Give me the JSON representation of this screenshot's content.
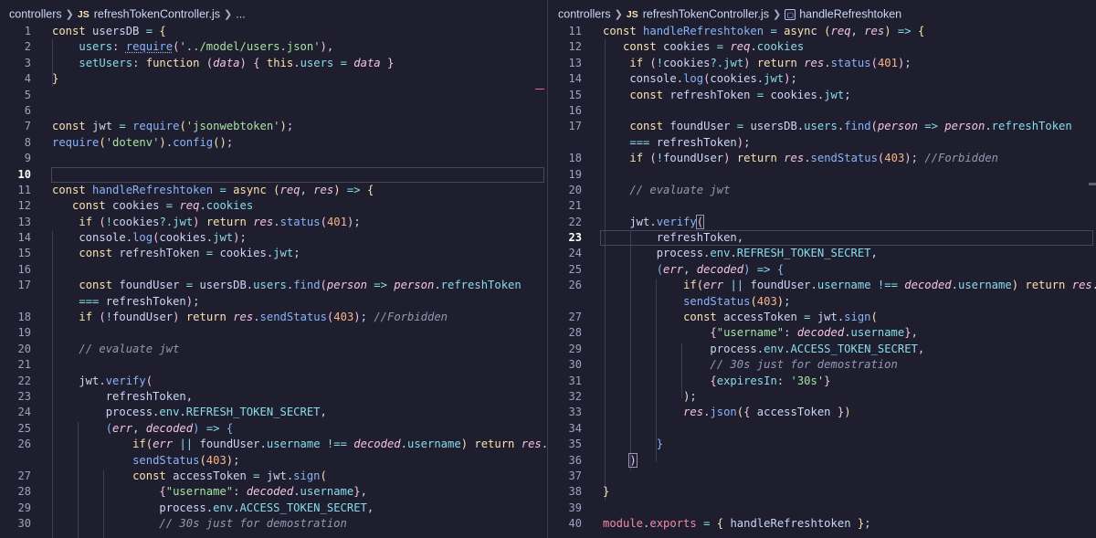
{
  "colors": {
    "background": "#1e1e2e",
    "keyword": "#f9e2af",
    "string": "#a6e3a1",
    "function": "#89b4fa",
    "parameter": "#f5c2e7",
    "comment": "#9399b2"
  },
  "left_editor": {
    "breadcrumb": {
      "folder": "controllers",
      "file_badge": "JS",
      "file": "refreshTokenController.js",
      "tail": "..."
    },
    "current_line": "10",
    "lines": [
      {
        "n": "1",
        "h": "<span class=\"kw\">const</span> usersDB <span class=\"op\">=</span> <span class=\"br1\">{</span>"
      },
      {
        "n": "2",
        "h": "    <span class=\"prop\">users</span>: <span class=\"fn sq\">require</span><span class=\"br2\">(</span><span class=\"str\">'../model/users.json'</span><span class=\"br2\">)</span>,"
      },
      {
        "n": "3",
        "h": "    <span class=\"prop\">setUsers</span>: <span class=\"kw\">function</span> <span class=\"br2\">(</span><span class=\"param\">data</span><span class=\"br2\">)</span> <span class=\"br2\">{</span> <span class=\"kw\">this</span>.<span class=\"prop\">users</span> <span class=\"op\">=</span> <span class=\"param\">data</span> <span class=\"br2\">}</span>"
      },
      {
        "n": "4",
        "h": "<span class=\"br1\">}</span>"
      },
      {
        "n": "5",
        "h": ""
      },
      {
        "n": "6",
        "h": ""
      },
      {
        "n": "7",
        "h": "<span class=\"kw\">const</span> jwt <span class=\"op\">=</span> <span class=\"fn\">require</span><span class=\"br1\">(</span><span class=\"str\">'jsonwebtoken'</span><span class=\"br1\">)</span>;"
      },
      {
        "n": "8",
        "h": "<span class=\"fn\">require</span><span class=\"br1\">(</span><span class=\"str\">'dotenv'</span><span class=\"br1\">)</span>.<span class=\"fn\">config</span><span class=\"br1\">()</span>;"
      },
      {
        "n": "9",
        "h": ""
      },
      {
        "n": "10",
        "h": ""
      },
      {
        "n": "11",
        "h": "<span class=\"kw\">const</span> <span class=\"fn\">handleRefreshtoken</span> <span class=\"op\">=</span> <span class=\"kw\">async</span> <span class=\"br1\">(</span><span class=\"param\">req</span>, <span class=\"param\">res</span><span class=\"br1\">)</span> <span class=\"op\">=&gt;</span> <span class=\"br1\">{</span>"
      },
      {
        "n": "12",
        "h": "   <span class=\"kw\">const</span> cookies <span class=\"op\">=</span> <span class=\"param\">req</span>.<span class=\"prop\">cookies</span>"
      },
      {
        "n": "13",
        "h": "    <span class=\"kw\">if</span> <span class=\"br2\">(</span><span class=\"op\">!</span>cookies<span class=\"op\">?.</span><span class=\"prop\">jwt</span><span class=\"br2\">)</span> <span class=\"kw\">return</span> <span class=\"param\">res</span>.<span class=\"fn\">status</span><span class=\"br2\">(</span><span class=\"num\">401</span><span class=\"br2\">)</span>;"
      },
      {
        "n": "14",
        "h": "    console.<span class=\"fn\">log</span><span class=\"br2\">(</span>cookies.<span class=\"prop\">jwt</span><span class=\"br2\">)</span>;"
      },
      {
        "n": "15",
        "h": "    <span class=\"kw\">const</span> refreshToken <span class=\"op\">=</span> cookies.<span class=\"prop\">jwt</span>;"
      },
      {
        "n": "16",
        "h": ""
      },
      {
        "n": "17",
        "h": "    <span class=\"kw\">const</span> foundUser <span class=\"op\">=</span> usersDB.<span class=\"prop\">users</span>.<span class=\"fn\">find</span><span class=\"br2\">(</span><span class=\"param\">person</span> <span class=\"op\">=&gt;</span> <span class=\"param\">person</span>.<span class=\"prop\">refreshToken</span>"
      },
      {
        "n": "",
        "h": "    <span class=\"op\">===</span> refreshToken<span class=\"br2\">)</span>;"
      },
      {
        "n": "18",
        "h": "    <span class=\"kw\">if</span> <span class=\"br2\">(</span><span class=\"op\">!</span>foundUser<span class=\"br2\">)</span> <span class=\"kw\">return</span> <span class=\"param\">res</span>.<span class=\"fn\">sendStatus</span><span class=\"br2\">(</span><span class=\"num\">403</span><span class=\"br2\">)</span>; <span class=\"cmt\">//Forbidden</span>"
      },
      {
        "n": "19",
        "h": ""
      },
      {
        "n": "20",
        "h": "    <span class=\"cmt\">// evaluate jwt</span>"
      },
      {
        "n": "21",
        "h": ""
      },
      {
        "n": "22",
        "h": "    jwt.<span class=\"fn\">verify</span><span class=\"br2\">(</span>"
      },
      {
        "n": "23",
        "h": "        refreshToken,"
      },
      {
        "n": "24",
        "h": "        process.<span class=\"prop\">env</span>.<span class=\"prop\">REFRESH_TOKEN_SECRET</span>,"
      },
      {
        "n": "25",
        "h": "        <span class=\"br3\">(</span><span class=\"param\">err</span>, <span class=\"param\">decoded</span><span class=\"br3\">)</span> <span class=\"op\">=&gt;</span> <span class=\"br3\">{</span>"
      },
      {
        "n": "26",
        "h": "            <span class=\"kw\">if</span><span class=\"br1\">(</span><span class=\"param\">err</span> <span class=\"op\">||</span> foundUser.<span class=\"prop\">username</span> <span class=\"op\">!==</span> <span class=\"param\">decoded</span>.<span class=\"prop\">username</span><span class=\"br1\">)</span> <span class=\"kw\">return</span> <span class=\"param\">res</span>."
      },
      {
        "n": "",
        "h": "            <span class=\"fn\">sendStatus</span><span class=\"br1\">(</span><span class=\"num\">403</span><span class=\"br1\">)</span>;"
      },
      {
        "n": "27",
        "h": "            <span class=\"kw\">const</span> accessToken <span class=\"op\">=</span> jwt.<span class=\"fn\">sign</span><span class=\"br1\">(</span>"
      },
      {
        "n": "28",
        "h": "                <span class=\"br2\">{</span><span class=\"str\">\"username\"</span>: <span class=\"param\">decoded</span>.<span class=\"prop\">username</span><span class=\"br2\">}</span>,"
      },
      {
        "n": "29",
        "h": "                process.<span class=\"prop\">env</span>.<span class=\"prop\">ACCESS_TOKEN_SECRET</span>,"
      },
      {
        "n": "30",
        "h": "                <span class=\"cmt\">// 30s just for demostration</span>"
      }
    ]
  },
  "right_editor": {
    "breadcrumb": {
      "folder": "controllers",
      "file_badge": "JS",
      "file": "refreshTokenController.js",
      "symbol": "handleRefreshtoken"
    },
    "current_line": "23",
    "lines": [
      {
        "n": "11",
        "h": "<span class=\"kw\">const</span> <span class=\"fn\">handleRefreshtoken</span> <span class=\"op\">=</span> <span class=\"kw\">async</span> <span class=\"br1\">(</span><span class=\"param\">req</span>, <span class=\"param\">res</span><span class=\"br1\">)</span> <span class=\"op\">=&gt;</span> <span class=\"br1\">{</span>"
      },
      {
        "n": "12",
        "h": "   <span class=\"kw\">const</span> cookies <span class=\"op\">=</span> <span class=\"param\">req</span>.<span class=\"prop\">cookies</span>"
      },
      {
        "n": "13",
        "h": "    <span class=\"kw\">if</span> <span class=\"br2\">(</span><span class=\"op\">!</span>cookies<span class=\"op\">?.</span><span class=\"prop\">jwt</span><span class=\"br2\">)</span> <span class=\"kw\">return</span> <span class=\"param\">res</span>.<span class=\"fn\">status</span><span class=\"br2\">(</span><span class=\"num\">401</span><span class=\"br2\">)</span>;"
      },
      {
        "n": "14",
        "h": "    console.<span class=\"fn\">log</span><span class=\"br2\">(</span>cookies.<span class=\"prop\">jwt</span><span class=\"br2\">)</span>;"
      },
      {
        "n": "15",
        "h": "    <span class=\"kw\">const</span> refreshToken <span class=\"op\">=</span> cookies.<span class=\"prop\">jwt</span>;"
      },
      {
        "n": "16",
        "h": ""
      },
      {
        "n": "17",
        "h": "    <span class=\"kw\">const</span> foundUser <span class=\"op\">=</span> usersDB.<span class=\"prop\">users</span>.<span class=\"fn\">find</span><span class=\"br2\">(</span><span class=\"param\">person</span> <span class=\"op\">=&gt;</span> <span class=\"param\">person</span>.<span class=\"prop\">refreshToken</span>"
      },
      {
        "n": "",
        "h": "    <span class=\"op\">===</span> refreshToken<span class=\"br2\">)</span>;"
      },
      {
        "n": "18",
        "h": "    <span class=\"kw\">if</span> <span class=\"br2\">(</span><span class=\"op\">!</span>foundUser<span class=\"br2\">)</span> <span class=\"kw\">return</span> <span class=\"param\">res</span>.<span class=\"fn\">sendStatus</span><span class=\"br2\">(</span><span class=\"num\">403</span><span class=\"br2\">)</span>; <span class=\"cmt\">//Forbidden</span>"
      },
      {
        "n": "19",
        "h": ""
      },
      {
        "n": "20",
        "h": "    <span class=\"cmt\">// evaluate jwt</span>"
      },
      {
        "n": "21",
        "h": ""
      },
      {
        "n": "22",
        "h": "    jwt.<span class=\"fn\">verify</span><span class=\"br2 brbox\">(</span>"
      },
      {
        "n": "23",
        "h": "        refreshToken,"
      },
      {
        "n": "24",
        "h": "        process.<span class=\"prop\">env</span>.<span class=\"prop\">REFRESH_TOKEN_SECRET</span>,"
      },
      {
        "n": "25",
        "h": "        <span class=\"br3\">(</span><span class=\"param\">err</span>, <span class=\"param\">decoded</span><span class=\"br3\">)</span> <span class=\"op\">=&gt;</span> <span class=\"br3\">{</span>"
      },
      {
        "n": "26",
        "h": "            <span class=\"kw\">if</span><span class=\"br1\">(</span><span class=\"param\">err</span> <span class=\"op\">||</span> foundUser.<span class=\"prop\">username</span> <span class=\"op\">!==</span> <span class=\"param\">decoded</span>.<span class=\"prop\">username</span><span class=\"br1\">)</span> <span class=\"kw\">return</span> <span class=\"param\">res</span>."
      },
      {
        "n": "",
        "h": "            <span class=\"fn\">sendStatus</span><span class=\"br1\">(</span><span class=\"num\">403</span><span class=\"br1\">)</span>;"
      },
      {
        "n": "27",
        "h": "            <span class=\"kw\">const</span> accessToken <span class=\"op\">=</span> jwt.<span class=\"fn\">sign</span><span class=\"br1\">(</span>"
      },
      {
        "n": "28",
        "h": "                <span class=\"br2\">{</span><span class=\"str\">\"username\"</span>: <span class=\"param\">decoded</span>.<span class=\"prop\">username</span><span class=\"br2\">}</span>,"
      },
      {
        "n": "29",
        "h": "                process.<span class=\"prop\">env</span>.<span class=\"prop\">ACCESS_TOKEN_SECRET</span>,"
      },
      {
        "n": "30",
        "h": "                <span class=\"cmt\">// 30s just for demostration</span>"
      },
      {
        "n": "31",
        "h": "                <span class=\"br2\">{</span><span class=\"prop\">expiresIn</span>: <span class=\"str\">'30s'</span><span class=\"br2\">}</span>"
      },
      {
        "n": "32",
        "h": "            <span class=\"br1\">)</span>;"
      },
      {
        "n": "33",
        "h": "            <span class=\"param\">res</span>.<span class=\"fn\">json</span><span class=\"br1\">(</span><span class=\"br2\">{</span> accessToken <span class=\"br2\">}</span><span class=\"br1\">)</span>"
      },
      {
        "n": "34",
        "h": ""
      },
      {
        "n": "35",
        "h": "        <span class=\"br3\">}</span>"
      },
      {
        "n": "36",
        "h": "    <span class=\"br2 brbox\">)</span>"
      },
      {
        "n": "37",
        "h": ""
      },
      {
        "n": "38",
        "h": "<span class=\"br1\">}</span>"
      },
      {
        "n": "39",
        "h": ""
      },
      {
        "n": "40",
        "h": "<span class=\"exp\">module</span>.<span class=\"exp\">exports</span> <span class=\"op\">=</span> <span class=\"br1\">{</span> handleRefreshtoken <span class=\"br1\">}</span>;"
      }
    ]
  }
}
